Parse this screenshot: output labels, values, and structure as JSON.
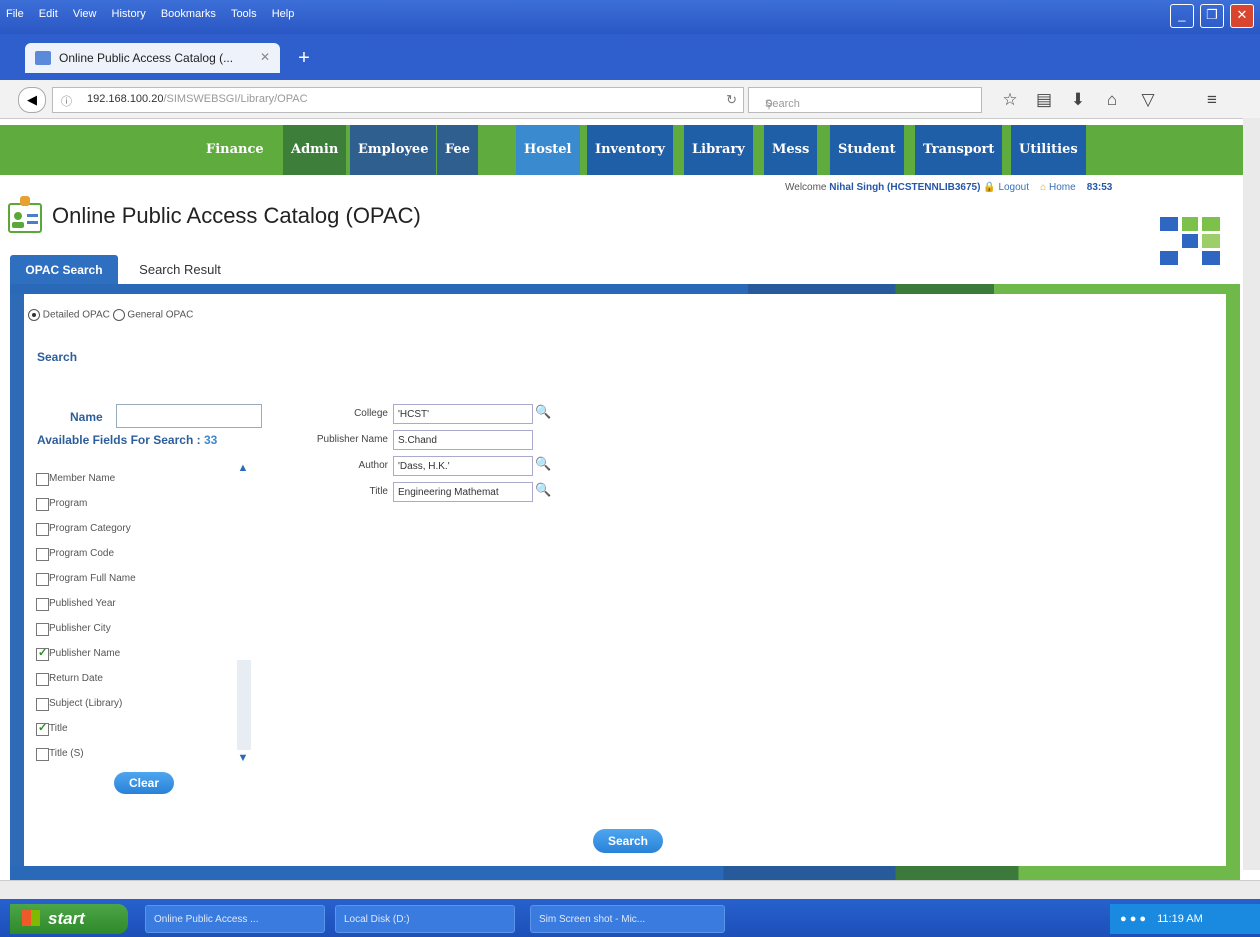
{
  "browser": {
    "menu": [
      "File",
      "Edit",
      "View",
      "History",
      "Bookmarks",
      "Tools",
      "Help"
    ],
    "tab_title": "Online Public Access Catalog (...",
    "url_host": "192.168.100.20",
    "url_path": "/SIMSWEBSGI/Library/OPAC",
    "search_placeholder": "Search"
  },
  "appnav": [
    "Finance",
    "Admin",
    "Employee",
    "Fee",
    "Hostel",
    "Inventory",
    "Library",
    "Mess",
    "Student",
    "Transport",
    "Utilities"
  ],
  "header": {
    "welcome": "Welcome",
    "user": "Nihal Singh (HCSTENNLIB3675)",
    "logout": "Logout",
    "home": "Home",
    "timer": "83:53",
    "title": "Online Public Access Catalog (OPAC)"
  },
  "tabs": {
    "opac": "OPAC Search",
    "result": "Search Result"
  },
  "mode": {
    "detailed": "Detailed OPAC",
    "general": "General OPAC",
    "selected": "detailed"
  },
  "search": {
    "heading": "Search",
    "name_label": "Name",
    "available_label": "Available Fields For Search :",
    "available_count": "33",
    "fields": [
      {
        "label": "Member Name",
        "checked": false
      },
      {
        "label": "Program",
        "checked": false
      },
      {
        "label": "Program Category",
        "checked": false
      },
      {
        "label": "Program Code",
        "checked": false
      },
      {
        "label": "Program Full Name",
        "checked": false
      },
      {
        "label": "Published Year",
        "checked": false
      },
      {
        "label": "Publisher City",
        "checked": false
      },
      {
        "label": "Publisher Name",
        "checked": true
      },
      {
        "label": "Return Date",
        "checked": false
      },
      {
        "label": "Subject (Library)",
        "checked": false
      },
      {
        "label": "Title",
        "checked": true
      },
      {
        "label": "Title (S)",
        "checked": false
      }
    ],
    "clear": "Clear",
    "submit": "Search",
    "criteria": [
      {
        "label": "College",
        "value": "'HCST'",
        "lookup": true
      },
      {
        "label": "Publisher Name",
        "value": "S.Chand",
        "lookup": false
      },
      {
        "label": "Author",
        "value": "'Dass, H.K.'",
        "lookup": true
      },
      {
        "label": "Title",
        "value": "Engineering Mathemat",
        "lookup": true
      }
    ]
  },
  "taskbar": {
    "start": "start",
    "items": [
      "Online Public Access ...",
      "Local Disk (D:)",
      "Sim Screen shot - Mic..."
    ],
    "time": "11:19 AM"
  }
}
